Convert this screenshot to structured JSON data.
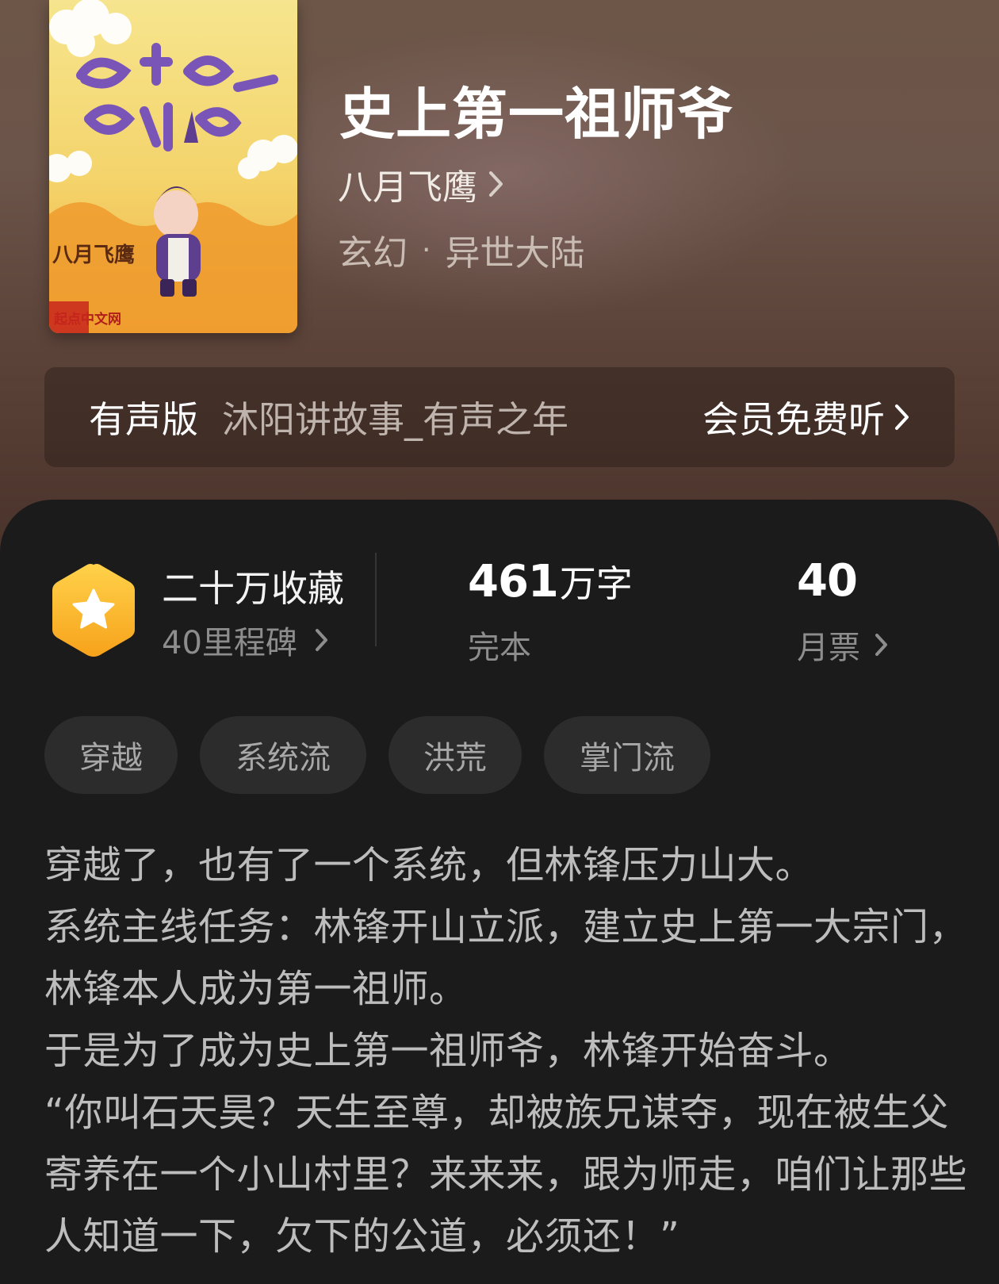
{
  "book": {
    "title": "史上第一祖师爷",
    "author": "八月飞鹰",
    "genre": "玄幻",
    "subgenre": "异世大陆",
    "genre_separator": "·"
  },
  "cover": {
    "title_text": "史上第一祖师爷",
    "author_text": "八月飞鹰",
    "publisher_text": "起点中文网"
  },
  "audio": {
    "tag": "有声版",
    "narrator": "沐阳讲故事_有声之年",
    "cta": "会员免费听"
  },
  "stats": {
    "collection": "二十万收藏",
    "milestone": "40里程碑",
    "word_count": "461",
    "word_unit": "万字",
    "status": "完本",
    "votes": "40",
    "votes_label": "月票"
  },
  "tags": [
    "穿越",
    "系统流",
    "洪荒",
    "掌门流"
  ],
  "synopsis": "穿越了，也有了一个系统，但林锋压力山大。\n系统主线任务：林锋开山立派，建立史上第一大宗门，林锋本人成为第一祖师。\n于是为了成为史上第一祖师爷，林锋开始奋斗。\n“你叫石天昊？天生至尊，却被族兄谋夺，现在被生父寄养在一个小山村里？来来来，跟为师走，咱们让那些人知道一下，欠下的公道，必须还！”",
  "colors": {
    "header_top": "#6d5648",
    "header_bottom": "#4a332b",
    "sheet_bg": "#1b1b1b",
    "pill_bg": "#2c2c2c",
    "badge_orange": "#f7a21b",
    "badge_yellow": "#ffd24a"
  },
  "icons": {
    "badge": "star-hexagon-icon",
    "chevron": "chevron-right-icon"
  }
}
